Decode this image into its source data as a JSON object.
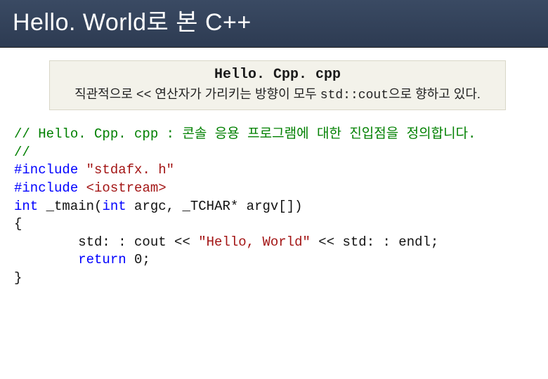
{
  "title": "Hello. World로 본 C++",
  "subtitle": {
    "file_name": "Hello. Cpp. cpp",
    "desc_prefix": "직관적으로 ",
    "desc_op": "<<",
    "desc_mid": " 연산자가 가리키는 방향이 모두 ",
    "desc_cout": "std::cout",
    "desc_suffix": "으로 향하고 있다."
  },
  "code": {
    "comment_line": "// Hello. Cpp. cpp : 콘솔 응용 프로그램에 대한 진입점을 정의합니다.",
    "comment_slash": "//",
    "include1_kw": "#include ",
    "include1_val": "\"stdafx. h\"",
    "include2_kw": "#include ",
    "include2_val": "<iostream>",
    "sig_int": "int",
    "sig_tmain": " _tmain(",
    "sig_int2": "int",
    "sig_argc": " argc, _TCHAR* argv[])",
    "brace_open": "{",
    "indent": "        ",
    "cout_stmt_pre": "std: : cout << ",
    "cout_str": "\"Hello, World\"",
    "cout_stmt_post": " << std: : endl;",
    "return_kw": "return",
    "return_rest": " 0;",
    "brace_close": "}"
  }
}
